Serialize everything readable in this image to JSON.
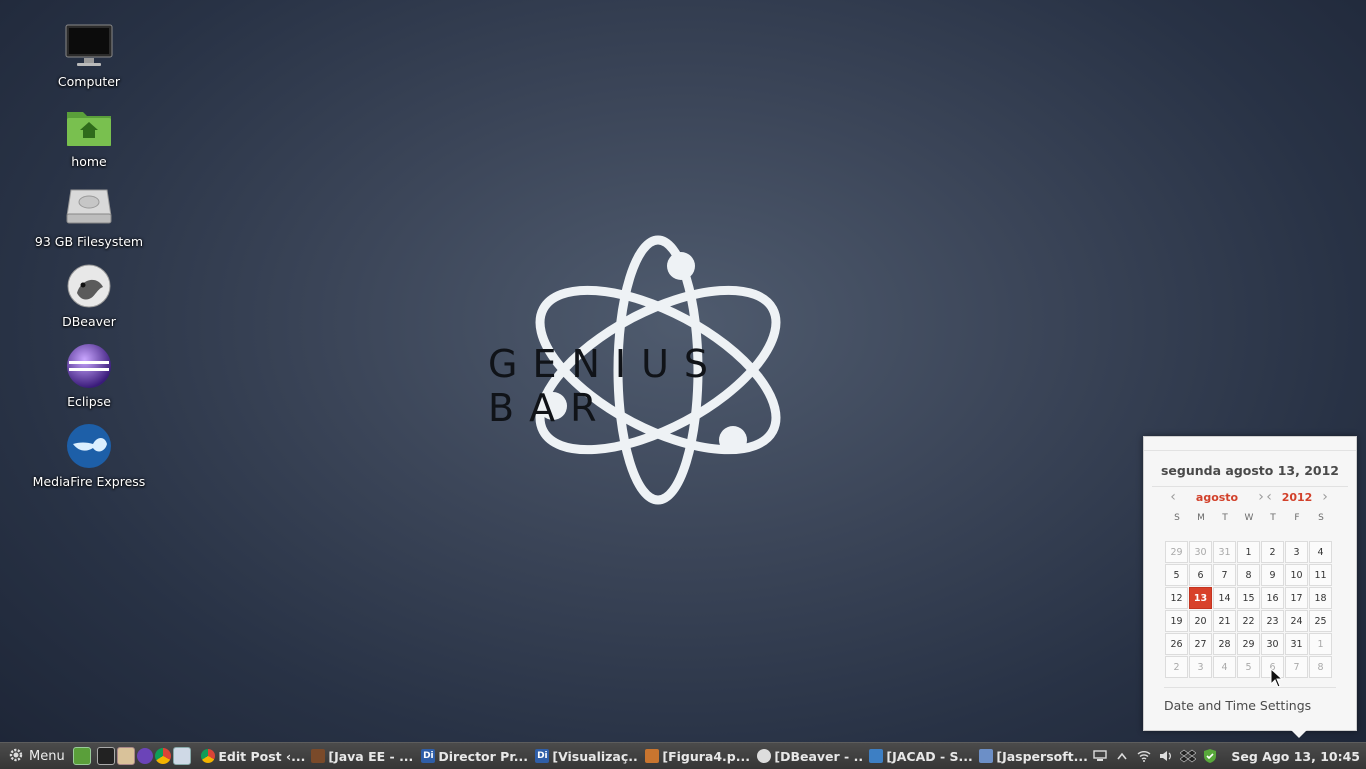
{
  "desktop": {
    "icons": [
      {
        "label": "Computer",
        "icon": "monitor-icon"
      },
      {
        "label": "home",
        "icon": "home-folder-icon"
      },
      {
        "label": "93 GB Filesystem",
        "icon": "hard-drive-icon"
      },
      {
        "label": "DBeaver",
        "icon": "dbeaver-icon"
      },
      {
        "label": "Eclipse",
        "icon": "eclipse-icon"
      },
      {
        "label": "MediaFire Express",
        "icon": "mediafire-icon"
      }
    ],
    "wallpaper_text": "GENIUS BAR"
  },
  "calendar": {
    "date_title": "segunda agosto 13, 2012",
    "month": "agosto",
    "year": "2012",
    "weekdays": [
      "S",
      "M",
      "T",
      "W",
      "T",
      "F",
      "S"
    ],
    "weeks": [
      [
        "29",
        "30",
        "31",
        "1",
        "2",
        "3",
        "4"
      ],
      [
        "5",
        "6",
        "7",
        "8",
        "9",
        "10",
        "11"
      ],
      [
        "12",
        "13",
        "14",
        "15",
        "16",
        "17",
        "18"
      ],
      [
        "19",
        "20",
        "21",
        "22",
        "23",
        "24",
        "25"
      ],
      [
        "26",
        "27",
        "28",
        "29",
        "30",
        "31",
        "1"
      ],
      [
        "2",
        "3",
        "4",
        "5",
        "6",
        "7",
        "8"
      ]
    ],
    "today": "13",
    "settings_label": "Date and Time Settings",
    "accent_color": "#d8412a"
  },
  "panel": {
    "menu_label": "Menu",
    "launchers": [
      "show-desktop-icon",
      "terminal-icon",
      "file-manager-icon",
      "eclipse-icon",
      "chrome-icon",
      "screenshot-icon"
    ],
    "tasks": [
      {
        "label": "Edit Post ‹...",
        "icon": "chrome-icon"
      },
      {
        "label": "[Java EE - ...",
        "icon": "java-icon"
      },
      {
        "label": "Director Pr...",
        "icon": "di-icon"
      },
      {
        "label": "[Visualizaç...",
        "icon": "di-icon"
      },
      {
        "label": "[Figura4.p...",
        "icon": "image-viewer-icon"
      },
      {
        "label": "[DBeaver - ...",
        "icon": "dbeaver-icon"
      },
      {
        "label": "[JACAD - S...",
        "icon": "jacad-icon"
      },
      {
        "label": "[Jaspersoft...",
        "icon": "jaspersoft-icon"
      }
    ],
    "tray": [
      "network-icon",
      "chevron-up-icon",
      "wifi-icon",
      "volume-icon",
      "dropbox-icon",
      "shield-icon"
    ],
    "clock": "Seg Ago 13, 10:45"
  }
}
